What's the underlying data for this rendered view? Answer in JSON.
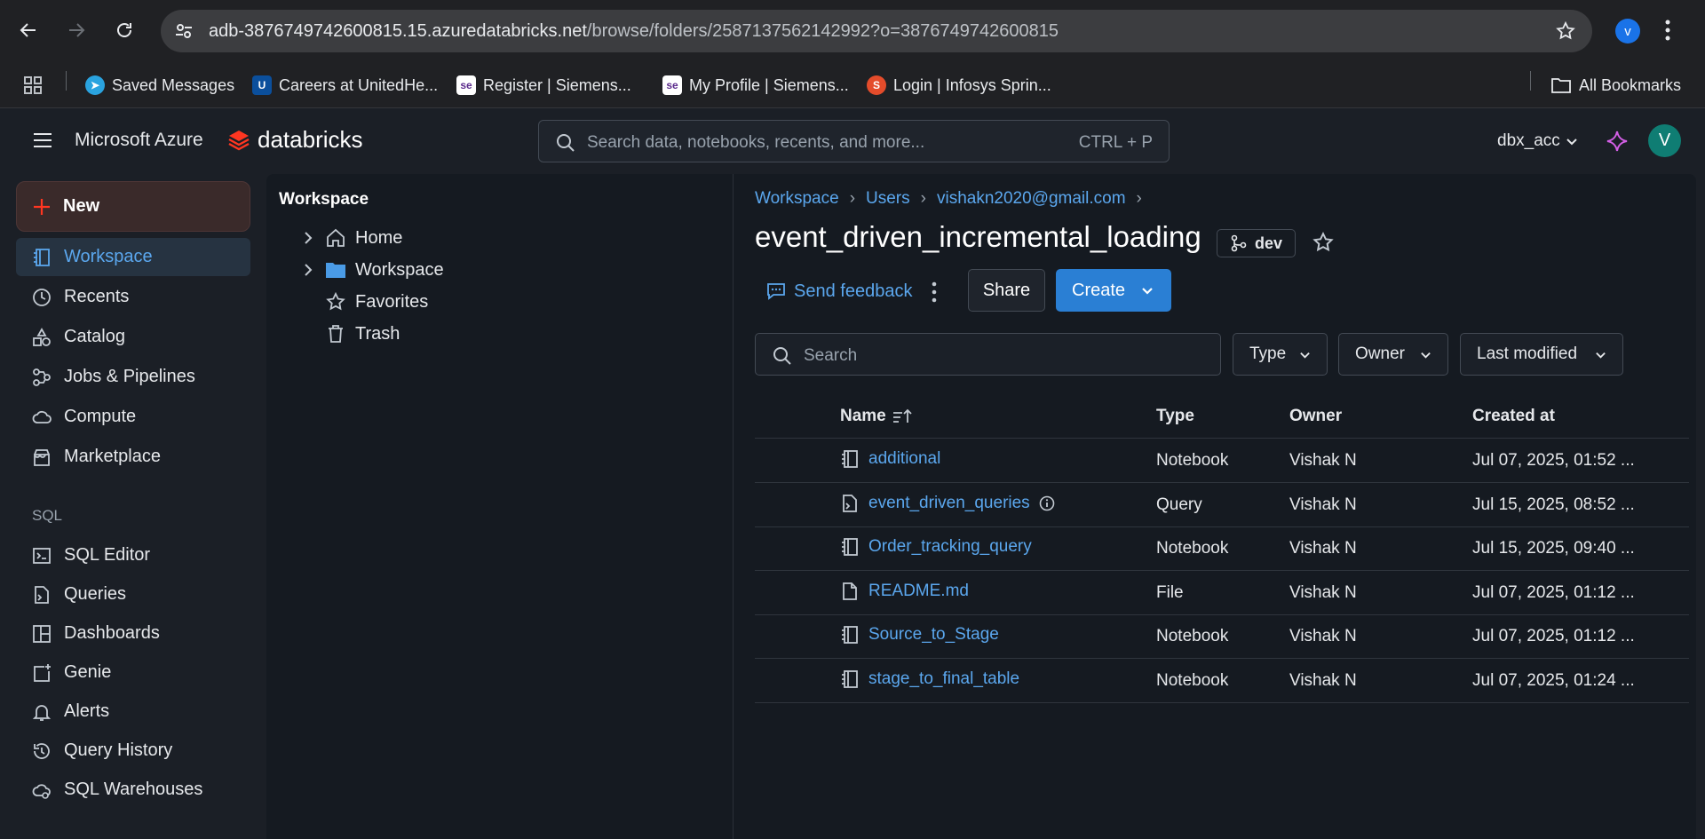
{
  "browser": {
    "url_host": "adb-3876749742600815.15.azuredatabricks.net",
    "url_path": "/browse/folders/2587137562142992?o=3876749742600815",
    "profile_initial": "v",
    "bookmarks": [
      {
        "label": "Saved Messages",
        "icon": "telegram-icon",
        "color": "#2aa3df"
      },
      {
        "label": "Careers at UnitedHe...",
        "icon": "unitedhealth-icon",
        "color": "#0b4f9c"
      },
      {
        "label": "Register | Siemens...",
        "icon": "siemens-icon",
        "color": "#ffffff"
      },
      {
        "label": "My Profile | Siemens...",
        "icon": "siemens-icon",
        "color": "#ffffff"
      },
      {
        "label": "Login | Infosys Sprin...",
        "icon": "infosys-icon",
        "color": "#e44c2b"
      }
    ],
    "all_bookmarks": "All Bookmarks"
  },
  "header": {
    "brand_ms": "Microsoft Azure",
    "brand_db": "databricks",
    "search_placeholder": "Search data, notebooks, recents, and more...",
    "search_shortcut": "CTRL + P",
    "workspace_name": "dbx_acc",
    "user_initial": "V"
  },
  "sidebar": {
    "new_label": "New",
    "items": [
      {
        "label": "Workspace",
        "icon": "workspace-icon"
      },
      {
        "label": "Recents",
        "icon": "clock-icon"
      },
      {
        "label": "Catalog",
        "icon": "catalog-icon"
      },
      {
        "label": "Jobs & Pipelines",
        "icon": "jobs-icon"
      },
      {
        "label": "Compute",
        "icon": "cloud-icon"
      },
      {
        "label": "Marketplace",
        "icon": "store-icon"
      }
    ],
    "sql_section": "SQL",
    "sql_items": [
      {
        "label": "SQL Editor",
        "icon": "sql-editor-icon"
      },
      {
        "label": "Queries",
        "icon": "query-icon"
      },
      {
        "label": "Dashboards",
        "icon": "dashboard-icon"
      },
      {
        "label": "Genie",
        "icon": "genie-icon"
      },
      {
        "label": "Alerts",
        "icon": "bell-icon"
      },
      {
        "label": "Query History",
        "icon": "history-icon"
      },
      {
        "label": "SQL Warehouses",
        "icon": "warehouse-icon"
      }
    ]
  },
  "tree": {
    "title": "Workspace",
    "items": [
      {
        "label": "Home",
        "icon": "home-icon"
      },
      {
        "label": "Workspace",
        "icon": "folder-icon"
      },
      {
        "label": "Favorites",
        "icon": "star-icon"
      },
      {
        "label": "Trash",
        "icon": "trash-icon"
      }
    ]
  },
  "content": {
    "breadcrumb": [
      "Workspace",
      "Users",
      "vishakn2020@gmail.com"
    ],
    "title": "event_driven_incremental_loading",
    "branch": "dev",
    "feedback": "Send feedback",
    "share": "Share",
    "create": "Create",
    "search_placeholder": "Search",
    "filters": [
      "Type",
      "Owner",
      "Last modified"
    ],
    "columns": [
      "Name",
      "Type",
      "Owner",
      "Created at"
    ],
    "rows": [
      {
        "name": "additional",
        "type": "Notebook",
        "owner": "Vishak N",
        "created": "Jul 07, 2025, 01:52 ...",
        "icon": "notebook-icon"
      },
      {
        "name": "event_driven_queries",
        "type": "Query",
        "owner": "Vishak N",
        "created": "Jul 15, 2025, 08:52 ...",
        "icon": "query-file-icon"
      },
      {
        "name": "Order_tracking_query",
        "type": "Notebook",
        "owner": "Vishak N",
        "created": "Jul 15, 2025, 09:40 ...",
        "icon": "notebook-icon"
      },
      {
        "name": "README.md",
        "type": "File",
        "owner": "Vishak N",
        "created": "Jul 07, 2025, 01:12 ...",
        "icon": "file-icon"
      },
      {
        "name": "Source_to_Stage",
        "type": "Notebook",
        "owner": "Vishak N",
        "created": "Jul 07, 2025, 01:12 ...",
        "icon": "notebook-icon"
      },
      {
        "name": "stage_to_final_table",
        "type": "Notebook",
        "owner": "Vishak N",
        "created": "Jul 07, 2025, 01:24 ...",
        "icon": "notebook-icon"
      }
    ]
  }
}
